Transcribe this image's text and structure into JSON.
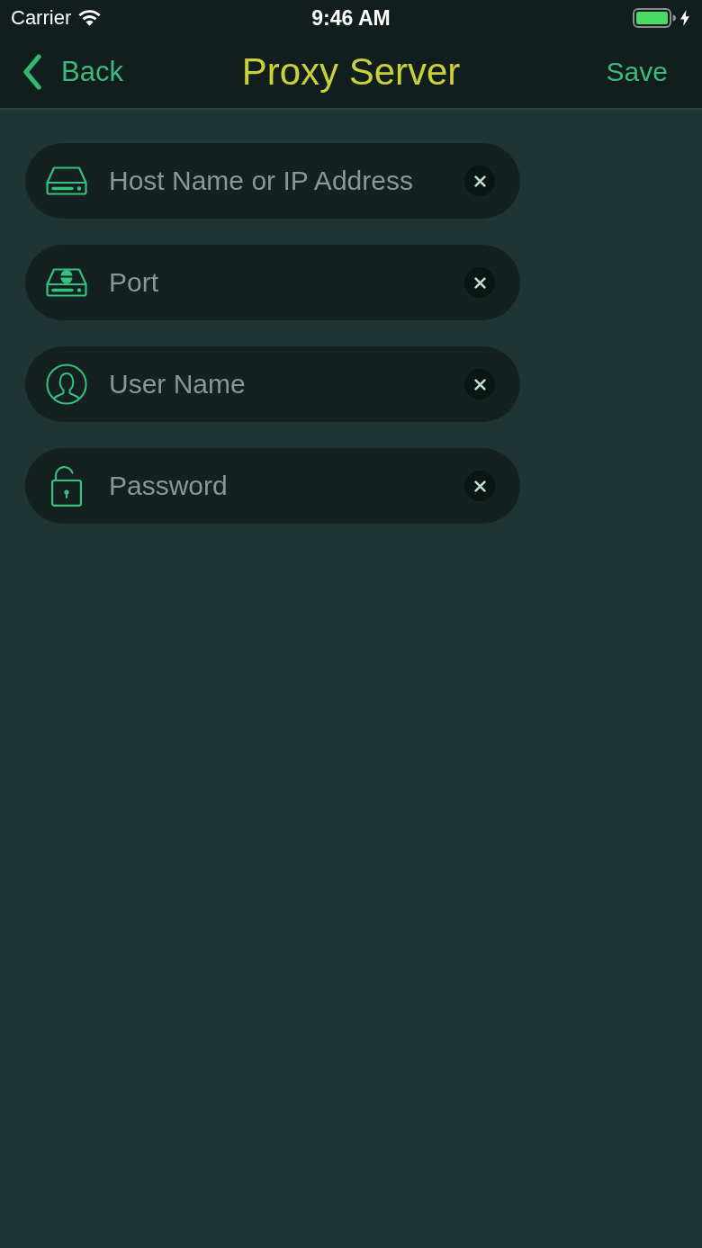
{
  "status_bar": {
    "carrier": "Carrier",
    "time": "9:46 AM",
    "charging": true
  },
  "nav_bar": {
    "back_label": "Back",
    "title": "Proxy Server",
    "action_label": "Save"
  },
  "fields": [
    {
      "kind": "host",
      "placeholder": "Host Name or IP Address"
    },
    {
      "kind": "port",
      "placeholder": "Port"
    },
    {
      "kind": "user",
      "placeholder": "User Name"
    },
    {
      "kind": "password",
      "placeholder": "Password"
    }
  ]
}
